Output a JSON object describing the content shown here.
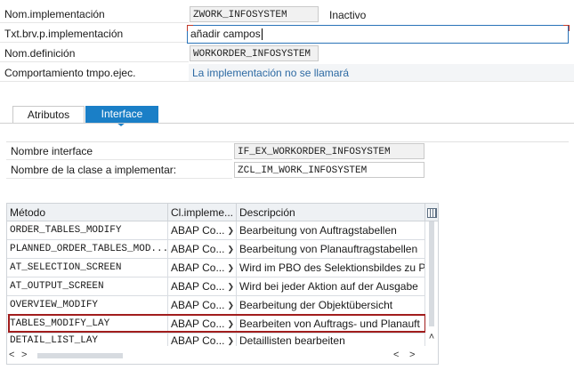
{
  "form": {
    "impl_name_label": "Nom.implementación",
    "impl_name_value": "ZWORK_INFOSYSTEM",
    "status": "Inactivo",
    "short_text_label": "Txt.brv.p.implementación",
    "short_text_value": "añadir campos",
    "definition_label": "Nom.definición",
    "definition_value": "WORKORDER_INFOSYSTEM",
    "runtime_label": "Comportamiento tmpo.ejec.",
    "runtime_value": "La implementación no se llamará"
  },
  "tabs": [
    {
      "label": "Atributos",
      "active": false
    },
    {
      "label": "Interface",
      "active": true
    }
  ],
  "interface": {
    "interface_name_label": "Nombre interface",
    "interface_name_value": "IF_EX_WORKORDER_INFOSYSTEM",
    "class_label": "Nombre de la clase a implementar:",
    "class_value": "ZCL_IM_WORK_INFOSYSTEM"
  },
  "grid": {
    "headers": [
      "Método",
      "Cl.impleme...",
      "Descripción"
    ],
    "rows": [
      {
        "method": "ORDER_TABLES_MODIFY",
        "cl": "ABAP Co...",
        "desc": "Bearbeitung von Auftragstabellen"
      },
      {
        "method": "PLANNED_ORDER_TABLES_MOD...",
        "cl": "ABAP Co...",
        "desc": "Bearbeitung von Planauftragstabellen"
      },
      {
        "method": "AT_SELECTION_SCREEN",
        "cl": "ABAP Co...",
        "desc": "Wird im PBO des Selektionsbildes zu P"
      },
      {
        "method": "AT_OUTPUT_SCREEN",
        "cl": "ABAP Co...",
        "desc": "Wird bei jeder Aktion auf der Ausgabe"
      },
      {
        "method": "OVERVIEW_MODIFY",
        "cl": "ABAP Co...",
        "desc": "Bearbeitung der Objektübersicht"
      },
      {
        "method": "TABLES_MODIFY_LAY",
        "cl": "ABAP Co...",
        "desc": "Bearbeiten von Auftrags- und Planauft"
      },
      {
        "method": "DETAIL_LIST_LAY",
        "cl": "ABAP Co...",
        "desc": "Detaillisten bearbeiten"
      }
    ],
    "highlighted_row": 5,
    "highlight_color": "#a11d1d"
  },
  "colors": {
    "active_tab": "#1a7fc7",
    "link_text": "#2d6aa3"
  }
}
